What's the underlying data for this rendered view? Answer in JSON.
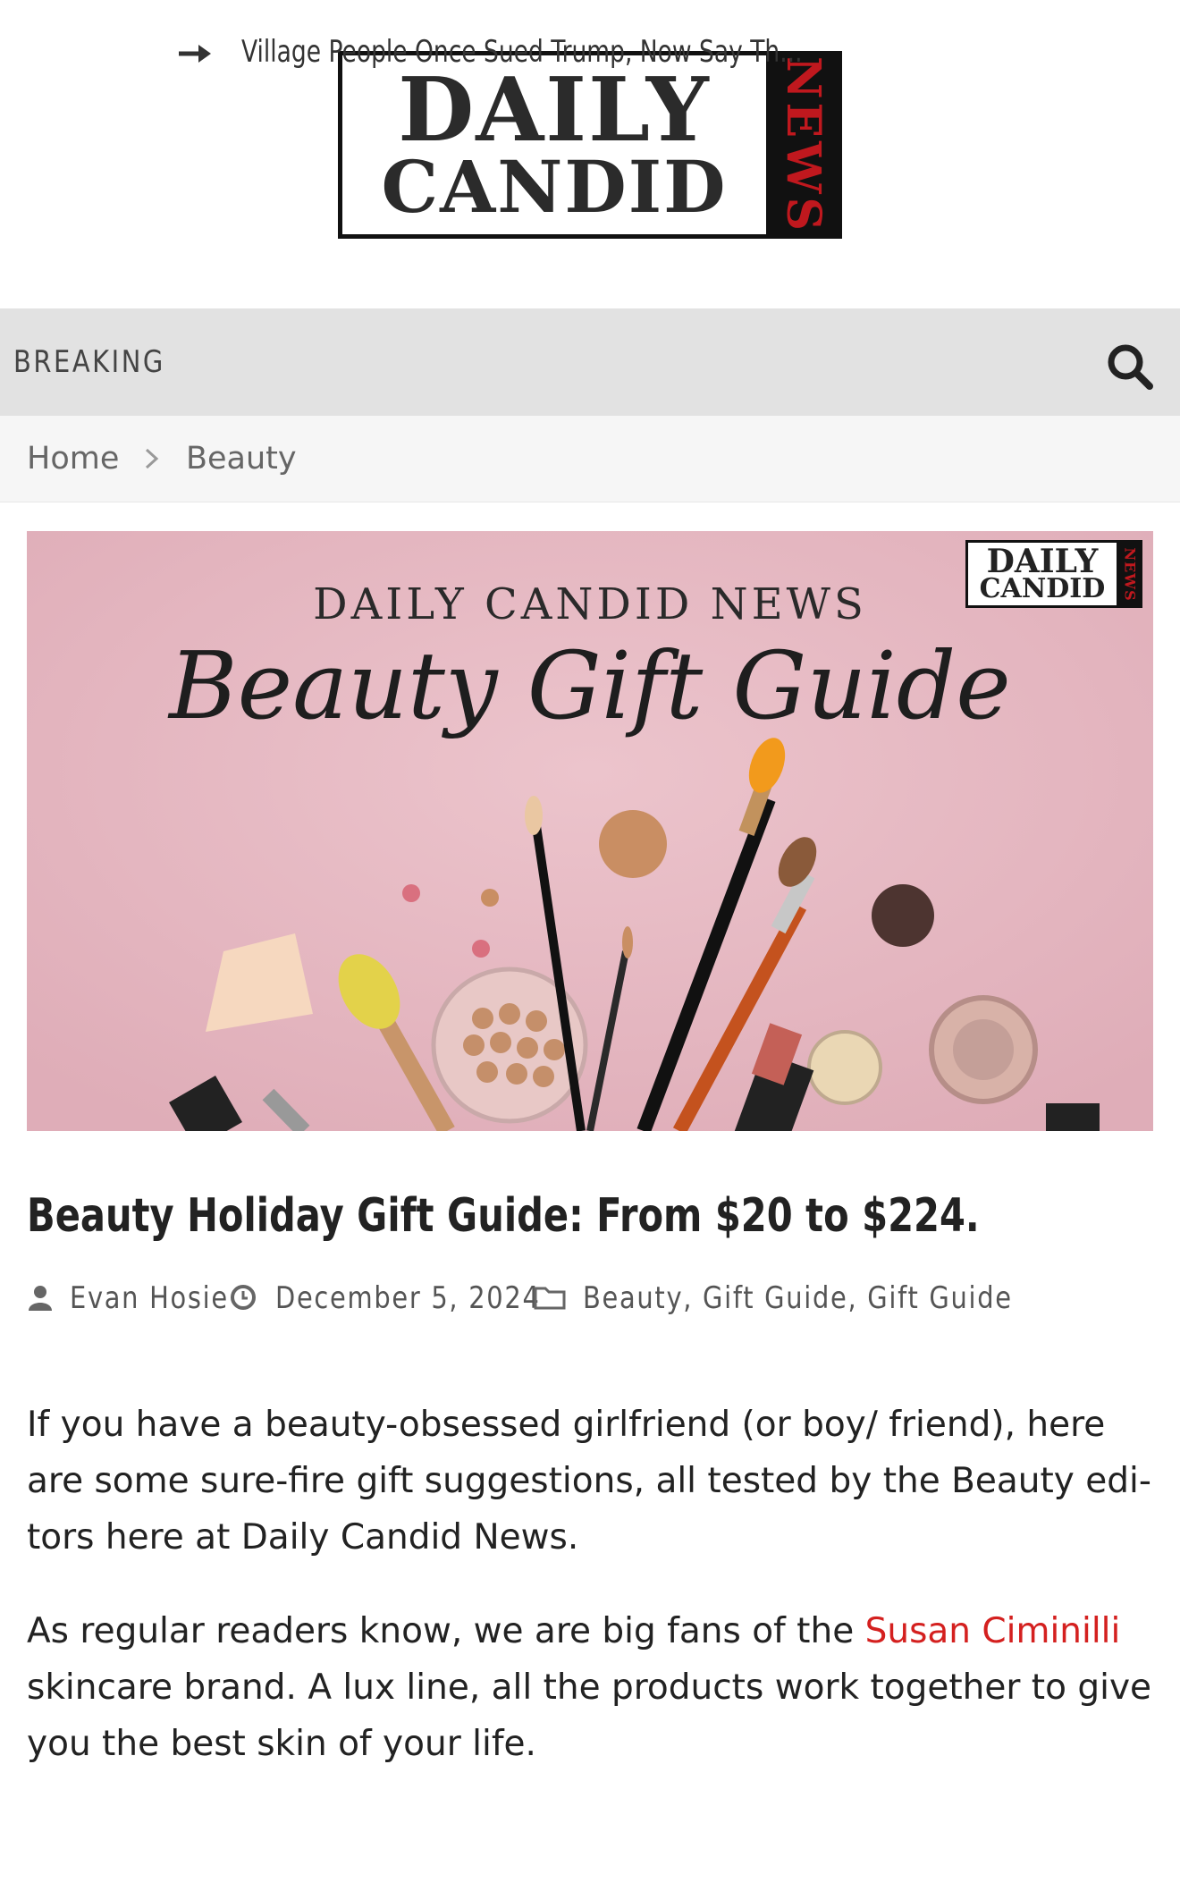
{
  "logo": {
    "line1": "DAILY",
    "line2": "CANDID",
    "side": "NEWS"
  },
  "breaking": {
    "label": "BREAKING",
    "headline": "Village People Once Sued Trump, Now Say Th..."
  },
  "breadcrumb": {
    "home": "Home",
    "current": "Beauty"
  },
  "hero": {
    "title": "DAILY CANDID NEWS",
    "script": "Beauty Gift Guide",
    "logo_line1": "DAILY",
    "logo_line2": "CANDID",
    "logo_side": "NEWS"
  },
  "post": {
    "title": "Beauty Holiday Gift Guide: From $20 to $224.",
    "author": "Evan Hosie",
    "date": "December 5, 2024",
    "categories": "Beauty, Gift Guide, Gift Guide",
    "p1": "If you have a beauty-obsessed girlfriend (or boy/ friend), here are some sure-fire gift suggestions, all tested by the Beauty edi­tors here at Daily Candid News.",
    "p2_before": "As regular readers know, we are big fans of the ",
    "p2_link": "Susan Ciminilli",
    "p2_after": " skincare brand. A lux line, all the products work together to give you the best skin of your life."
  },
  "colors": {
    "accent": "#d4201f",
    "breaking_bg": "#e2e2e2",
    "hero_bg": "#e7b9c2"
  },
  "icons": [
    "arrow-right-icon",
    "search-icon",
    "chevron-right-icon",
    "user-icon",
    "clock-icon",
    "folder-icon"
  ]
}
